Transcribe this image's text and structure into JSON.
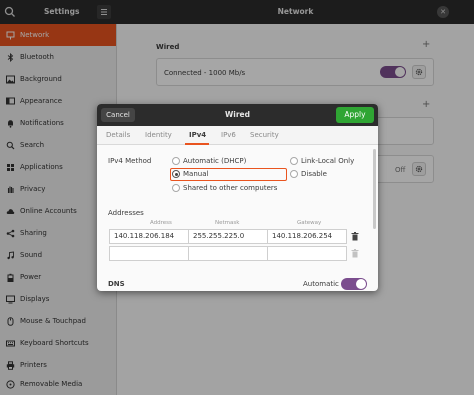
{
  "window": {
    "left_title": "Settings",
    "right_title": "Network"
  },
  "sidebar": {
    "items": [
      {
        "label": "Network",
        "icon": "network-icon"
      },
      {
        "label": "Bluetooth",
        "icon": "bluetooth-icon"
      },
      {
        "label": "Background",
        "icon": "background-icon"
      },
      {
        "label": "Appearance",
        "icon": "appearance-icon"
      },
      {
        "label": "Notifications",
        "icon": "bell-icon"
      },
      {
        "label": "Search",
        "icon": "search-icon"
      },
      {
        "label": "Applications",
        "icon": "grid-icon"
      },
      {
        "label": "Privacy",
        "icon": "hand-icon"
      },
      {
        "label": "Online Accounts",
        "icon": "cloud-icon"
      },
      {
        "label": "Sharing",
        "icon": "share-icon"
      },
      {
        "label": "Sound",
        "icon": "music-icon"
      },
      {
        "label": "Power",
        "icon": "power-icon"
      },
      {
        "label": "Displays",
        "icon": "display-icon"
      },
      {
        "label": "Mouse & Touchpad",
        "icon": "mouse-icon"
      },
      {
        "label": "Keyboard Shortcuts",
        "icon": "keyboard-icon"
      },
      {
        "label": "Printers",
        "icon": "printer-icon"
      },
      {
        "label": "Removable Media",
        "icon": "media-icon"
      }
    ]
  },
  "main": {
    "wired_title": "Wired",
    "wired_status": "Connected - 1000 Mb/s",
    "vpn_off": "Off"
  },
  "dialog": {
    "cancel_label": "Cancel",
    "title": "Wired",
    "apply_label": "Apply",
    "tabs": [
      "Details",
      "Identity",
      "IPv4",
      "IPv6",
      "Security"
    ],
    "ipv4_method_label": "IPv4 Method",
    "methods": {
      "auto": "Automatic (DHCP)",
      "link_local": "Link-Local Only",
      "manual": "Manual",
      "disable": "Disable",
      "shared": "Shared to other computers"
    },
    "addresses_label": "Addresses",
    "columns": [
      "Address",
      "Netmask",
      "Gateway"
    ],
    "rows": [
      {
        "address": "140.118.206.184",
        "netmask": "255.255.225.0",
        "gateway": "140.118.206.254"
      },
      {
        "address": "",
        "netmask": "",
        "gateway": ""
      }
    ],
    "dns_label": "DNS",
    "dns_auto_label": "Automatic"
  },
  "colors": {
    "accent": "#e9541f",
    "apply": "#2fa533",
    "toggle": "#7b4d8e"
  }
}
